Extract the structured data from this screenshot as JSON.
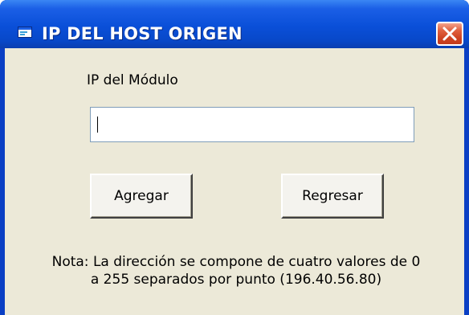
{
  "window": {
    "title": "IP DEL HOST ORIGEN",
    "icon": "form-window-icon",
    "close_icon": "close-icon"
  },
  "form": {
    "ip_label": "IP del Módulo",
    "ip_value": "",
    "add_button": "Agregar",
    "back_button": "Regresar"
  },
  "note": {
    "line1": "Nota: La dirección se compone de cuatro valores de 0",
    "line2": "a 255 separados por punto (196.40.56.80)"
  },
  "colors": {
    "titlebar": "#0a4fd8",
    "client_background": "#ece9d8",
    "close_button": "#cf4422"
  }
}
